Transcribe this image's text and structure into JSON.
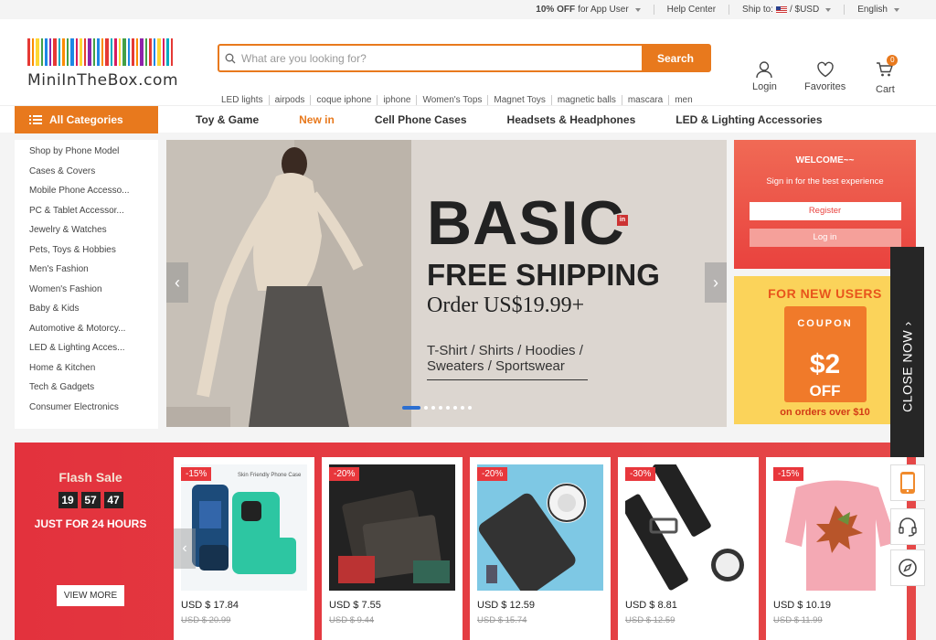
{
  "topbar": {
    "promo_bold": "10% OFF",
    "promo_text": " for App User",
    "help": "Help Center",
    "ship_label": "Ship to:",
    "currency": "/ $USD",
    "language": "English"
  },
  "logo": {
    "text": "MiniInTheBox.com"
  },
  "search": {
    "placeholder": "What are you looking for?",
    "button": "Search"
  },
  "hotwords": [
    "LED lights",
    "airpods",
    "coque iphone",
    "iphone",
    "Women's Tops",
    "Magnet Toys",
    "magnetic balls",
    "mascara",
    "men"
  ],
  "account": {
    "login": "Login",
    "favorites": "Favorites",
    "cart": "Cart",
    "cart_count": "0"
  },
  "nav": {
    "all_categories": "All Categories",
    "links": [
      "Toy & Game",
      "New in",
      "Cell Phone Cases",
      "Headsets & Headphones",
      "LED & Lighting Accessories"
    ]
  },
  "categories": [
    "Shop by Phone Model",
    "Cases & Covers",
    "Mobile Phone Accesso...",
    "PC & Tablet Accessor...",
    "Jewelry & Watches",
    "Pets, Toys & Hobbies",
    "Men's Fashion",
    "Women's Fashion",
    "Baby & Kids",
    "Automotive & Motorcy...",
    "LED & Lighting Acces...",
    "Home & Kitchen",
    "Tech & Gadgets",
    "Consumer Electronics"
  ],
  "banner": {
    "headline": "BASIC",
    "badge": "in",
    "line2": "FREE SHIPPING",
    "line3": "Order US$19.99+",
    "line4": "T-Shirt / Shirts / Hoodies / Sweaters / Sportswear",
    "prev": "‹",
    "next": "›"
  },
  "welcome": {
    "title": "WELCOME~~",
    "subtitle": "Sign in for the best experience",
    "register": "Register",
    "login": "Log in"
  },
  "coupon": {
    "title": "FOR NEW USERS",
    "label": "COUPON",
    "amount": "$2",
    "off": "OFF",
    "condition": "on orders over $10"
  },
  "flash": {
    "title": "Flash Sale",
    "timer": [
      "19",
      "57",
      "47"
    ],
    "subtitle": "JUST FOR 24 HOURS",
    "view_more": "VIEW MORE",
    "products": [
      {
        "discount": "-15%",
        "price": "USD $ 17.84",
        "old": "USD $ 20.99",
        "img_caption": "Skin Friendly Phone Case"
      },
      {
        "discount": "-20%",
        "price": "USD $ 7.55",
        "old": "USD $ 9.44"
      },
      {
        "discount": "-20%",
        "price": "USD $ 12.59",
        "old": "USD $ 15.74"
      },
      {
        "discount": "-30%",
        "price": "USD $ 8.81",
        "old": "USD $ 12.59"
      },
      {
        "discount": "-15%",
        "price": "USD $ 10.19",
        "old": "USD $ 11.99"
      }
    ]
  },
  "sidetab": {
    "close": "CLOSE NOW"
  },
  "colors": {
    "accent": "#e8791d",
    "flash_bg": "#e3323d",
    "coupon_bg": "#fbd35a"
  }
}
